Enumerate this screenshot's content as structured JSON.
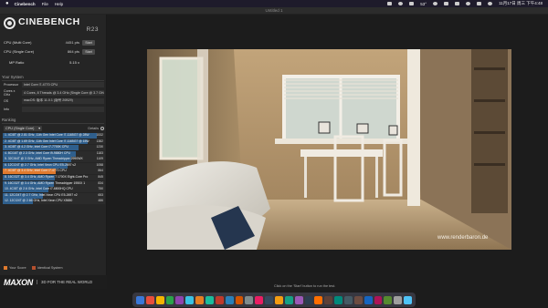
{
  "menubar": {
    "apple": "",
    "app_name": "Cinebench",
    "items": [
      "File",
      "Help"
    ],
    "status": {
      "temp": "53°",
      "clock": "11月17日 周三 下午4:48"
    }
  },
  "window": {
    "title": "Untitled 1"
  },
  "logo": {
    "name": "CINEBENCH",
    "version": "R23"
  },
  "scores": [
    {
      "label": "CPU (Multi Core)",
      "value": "4451 pts",
      "button": "Start"
    },
    {
      "label": "CPU (Single Core)",
      "value": "864 pts",
      "button": "Start"
    }
  ],
  "mp_ratio": {
    "label": "MP Ratio",
    "value": "5.15 x"
  },
  "system": {
    "title": "Your System",
    "rows": [
      {
        "key": "Processor",
        "value": "Intel Core i7-4770 CPU"
      },
      {
        "key": "Cores x GHz",
        "value": "4 Cores, 8 Threads @ 3.4 GHz (Single Core @ 3.7 GHz)"
      },
      {
        "key": "OS",
        "value": "macOS: 版本 11.0.1 (版号 20B29)"
      },
      {
        "key": "Info",
        "value": ""
      }
    ]
  },
  "ranking": {
    "title": "Ranking",
    "select": "CPU (Single Core)",
    "details": "Details",
    "rows": [
      {
        "rank": "1.",
        "desc": "4C/8T @ 2.81 GHz, 11th Gen Intel Core i7-1165G7 @ 28W",
        "score": "1532",
        "pct": 1.0,
        "highlight": false
      },
      {
        "rank": "2.",
        "desc": "4C/8T @ 1.69 GHz, 11th Gen Intel Core i7-1165G7 @ 15W",
        "score": "1382",
        "pct": 0.902,
        "highlight": false
      },
      {
        "rank": "3.",
        "desc": "4C/8T @ 4.2 GHz, Intel Core i7-7700K CPU",
        "score": "1230",
        "pct": 0.803,
        "highlight": false
      },
      {
        "rank": "4.",
        "desc": "8C/16T @ 2.3 GHz, Intel Core i9-9880H CPU",
        "score": "1183",
        "pct": 0.772,
        "highlight": false
      },
      {
        "rank": "5.",
        "desc": "32C/64T @ 3 GHz, AMD Ryzen Threadripper 2990WX",
        "score": "1109",
        "pct": 0.724,
        "highlight": false
      },
      {
        "rank": "6.",
        "desc": "12C/24T @ 2.7 GHz, Intel Xeon CPU E5-2697 v2",
        "score": "1058",
        "pct": 0.691,
        "highlight": false
      },
      {
        "rank": "7.",
        "desc": "4C/8T @ 3.4 GHz, Intel Core i7-4770 CPU",
        "score": "864",
        "pct": 0.564,
        "highlight": true
      },
      {
        "rank": "8.",
        "desc": "16C/32T @ 3.4 GHz, AMD Ryzen 7 1700X Eight-Core Pro",
        "score": "845",
        "pct": 0.552,
        "highlight": false
      },
      {
        "rank": "9.",
        "desc": "16C/32T @ 3.4 GHz, AMD Ryzen Threadripper 1950X 1",
        "score": "834",
        "pct": 0.544,
        "highlight": false
      },
      {
        "rank": "10.",
        "desc": "4C/8T @ 2.6 GHz, Intel Core i7-6800HQ CPU",
        "score": "750",
        "pct": 0.49,
        "highlight": false
      },
      {
        "rank": "11.",
        "desc": "12C/24T @ 2.7 GHz, Intel Xeon CPU E5-2697 v2",
        "score": "653",
        "pct": 0.426,
        "highlight": false
      },
      {
        "rank": "12.",
        "desc": "12C/24T @ 2.66 GHz, Intel Xeon CPU X5650",
        "score": "486",
        "pct": 0.317,
        "highlight": false
      }
    ]
  },
  "legend": [
    {
      "label": "Your Score",
      "color": "#e07a2e"
    },
    {
      "label": "Identical System",
      "color": "#b5502e"
    }
  ],
  "footer": {
    "brand": "MAXON",
    "tagline": "3D FOR THE REAL WORLD"
  },
  "render": {
    "watermark": "www.renderbaron.de"
  },
  "status": "Click on the 'Start' button to run the test."
}
